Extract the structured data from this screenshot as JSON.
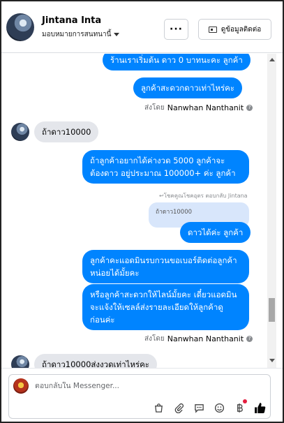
{
  "header": {
    "contact_name": "Jintana Inta",
    "assign_label": "มอบหมายการสนทนานี้",
    "more_label": "···",
    "detail_label": "ดูข้อมูลติดต่อ"
  },
  "messages": {
    "m1": "ร้านเราเริ่มต้น ดาว 0 บาทนะคะ ลูกค้า",
    "m2": "ลูกค้าสะดวกดาวเท่าไหร่คะ",
    "sent_by_prefix": "ส่งโดย",
    "sent_by_name_1": "Nanwhan Nanthanit",
    "m3": "ถ้าดาว10000",
    "m4_line1": "ถ้าลูกค้าอยากได้ค่างวด 5000 ลูกค้าจะ",
    "m4_line2": "ต้องดาว อยู่ประมาณ 100000+ ค่ะ ลูกค้า",
    "reply_note": "↩โชคคูณโชคอุตร ตอบกลับ Jintana",
    "quoted": "ถ้าดาว10000",
    "m5": "ดาวได้ค่ะ ลูกค้า",
    "m6_line1": "ลูกค้าคะแอดมินรบกวนขอเบอร์ติดต่อลูกค้า",
    "m6_line2": "หน่อยได้มั้ยคะ",
    "m7_line1": "หรือลูกค้าสะดวกให้ไลน์มั้ยคะ เดี๋ยวแอดมิน",
    "m7_line2": "จะแจ้งให้เซลล์ส่งรายละเอียดให้ลูกค้าดู",
    "m7_line3": "ก่อนค่ะ",
    "sent_by_name_2": "Nanwhan Nanthanit",
    "m8": "ถ้าดาว10000ส่งงวดเท่าไหร่คะ",
    "help_mark": "?"
  },
  "composer": {
    "placeholder": "ตอบกลับใน Messenger...",
    "tools": [
      "shopping-bag-icon",
      "paperclip-icon",
      "quick-reply-icon",
      "emoji-icon",
      "baht-icon",
      "like-icon"
    ]
  },
  "colors": {
    "outgoing": "#0084ff",
    "incoming": "#e4e6eb",
    "like": "#050505"
  }
}
